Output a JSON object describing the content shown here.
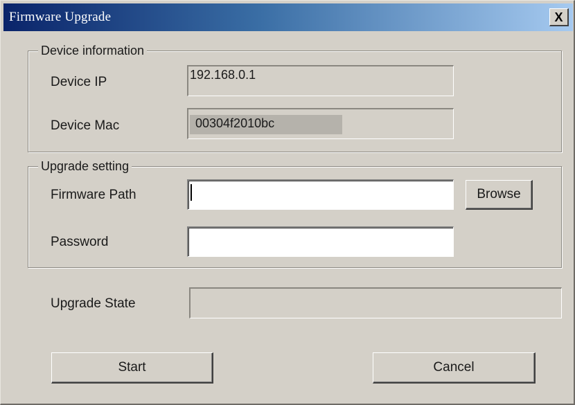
{
  "window": {
    "title": "Firmware Upgrade",
    "close_glyph": "X"
  },
  "device_info": {
    "legend": "Device information",
    "ip_label": "Device IP",
    "ip_value": "192.168.0.1",
    "mac_label": "Device Mac",
    "mac_value": "00304f2010bc"
  },
  "upgrade_setting": {
    "legend": "Upgrade setting",
    "firmware_path_label": "Firmware Path",
    "firmware_path_value": "",
    "browse_label": "Browse",
    "password_label": "Password",
    "password_value": ""
  },
  "upgrade_state": {
    "label": "Upgrade State",
    "value": ""
  },
  "actions": {
    "start_label": "Start",
    "cancel_label": "Cancel"
  },
  "colors": {
    "dialog_bg": "#d4d0c8",
    "title_gradient_start": "#0a246a",
    "title_gradient_end": "#a6caf0",
    "title_text": "#ffffff"
  }
}
